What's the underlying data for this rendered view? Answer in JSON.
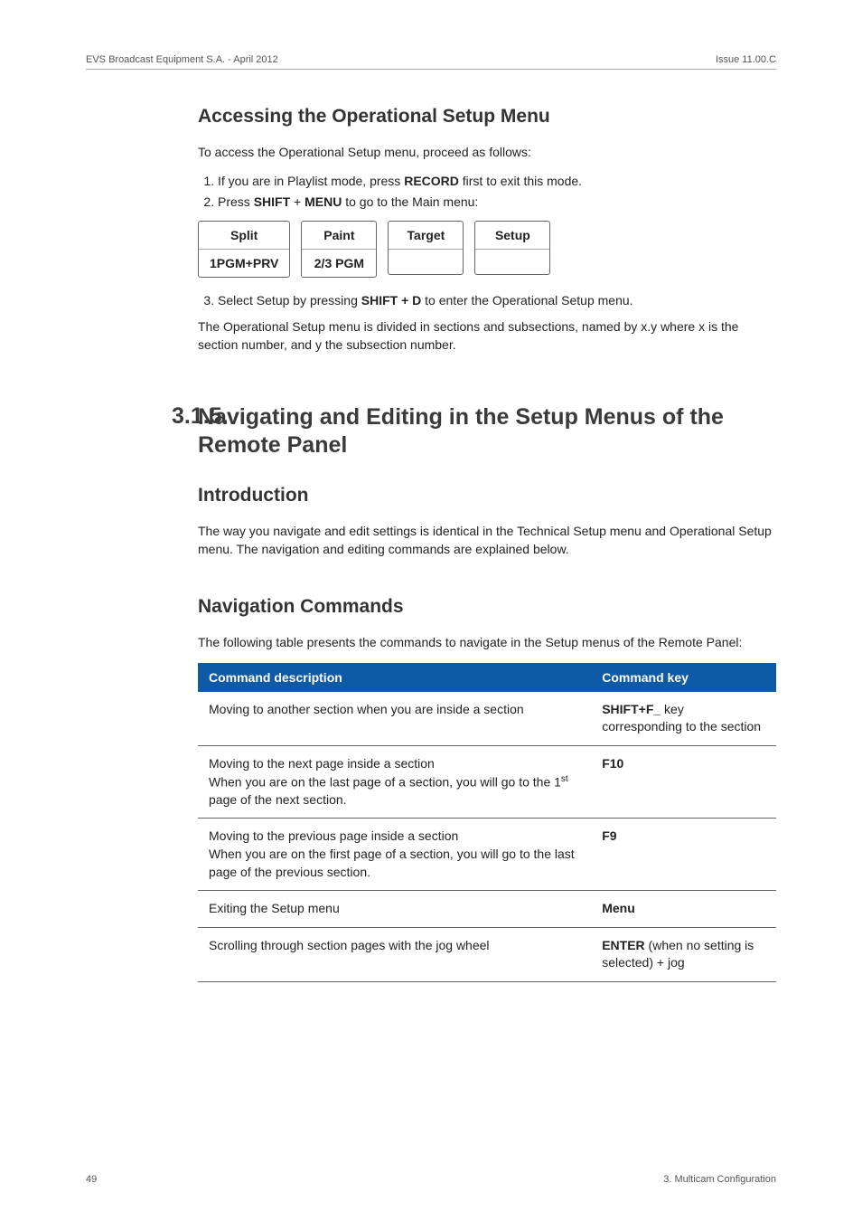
{
  "header": {
    "left": "EVS Broadcast Equipment S.A. - April 2012",
    "right": "Issue 11.00.C"
  },
  "accessing": {
    "title": "Accessing the Operational Setup Menu",
    "intro": "To access the Operational Setup menu, proceed as follows:",
    "step1_pre": "If you are in Playlist mode, press ",
    "step1_bold": "RECORD",
    "step1_post": " first to exit this mode.",
    "step2_pre": "Press ",
    "step2_b1": "SHIFT",
    "step2_mid": " + ",
    "step2_b2": "MENU",
    "step2_post": " to go to the Main menu:",
    "buttons": {
      "c0t": "Split",
      "c0b": "1PGM+PRV",
      "c1t": "Paint",
      "c1b": "2/3 PGM",
      "c2t": "Target",
      "c2b": "",
      "c3t": "Setup",
      "c3b": ""
    },
    "step3_pre": "Select Setup by pressing ",
    "step3_bold": "SHIFT + D",
    "step3_post": " to enter the Operational Setup menu.",
    "note": "The Operational Setup menu is divided in sections and subsections, named by x.y where x is the section number, and y the subsection number."
  },
  "section": {
    "num": "3.1.5.",
    "title": "Navigating and Editing in the Setup Menus of the Remote Panel",
    "intro_h": "Introduction",
    "intro_p": "The way you navigate and edit settings is identical in the Technical Setup menu and Operational Setup menu. The navigation and editing commands are explained below.",
    "nav_h": "Navigation Commands",
    "nav_p": "The following table presents the commands to navigate in the Setup menus of the Remote Panel:",
    "th1": "Command description",
    "th2": "Command key",
    "rows": {
      "r0d": "Moving to another section when you are inside a section",
      "r0k_b": "SHIFT+F_",
      "r0k_rest": " key corresponding to the section",
      "r1d_l1": "Moving to the next page inside a section",
      "r1d_l2a": "When you are on the last page of a section, you will go to the 1",
      "r1d_l2b": " page of the next section.",
      "r1k": "F10",
      "r2d_l1": "Moving to the previous page inside a section",
      "r2d_l2": "When you are on the first page of a section, you will go to the last page of the previous section.",
      "r2k": "F9",
      "r3d": "Exiting the Setup menu",
      "r3k": "Menu",
      "r4d": "Scrolling through section pages with the jog wheel",
      "r4k_b": "ENTER",
      "r4k_rest": " (when no setting is selected) + jog"
    }
  },
  "footer": {
    "left": "49",
    "right": "3. Multicam Configuration"
  }
}
